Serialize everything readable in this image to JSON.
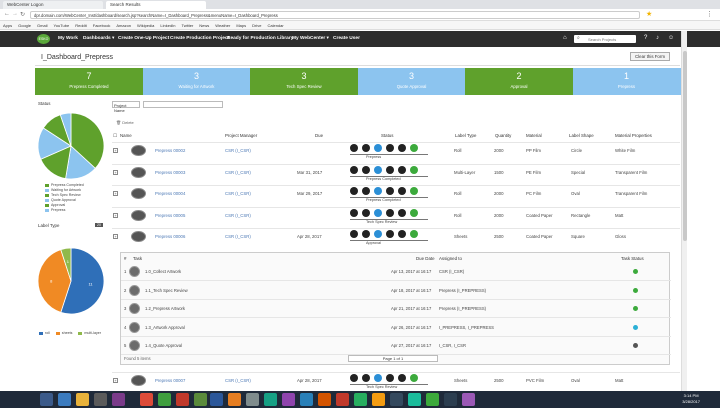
{
  "browser": {
    "tabs": [
      "WebCenter Logon",
      "Search Results"
    ],
    "url": "dpr.domain.com/WebCenter_Inst/dashboard/search.jsp?searchName=I_Dashboard_Prepress&menuName=I_Dashboard_Prepress",
    "bookmarks": [
      "Apps",
      "Google",
      "Gmail",
      "YouTube",
      "Reddit",
      "Facebook",
      "Amazon",
      "Wikipedia",
      "LinkedIn",
      "Twitter",
      "News",
      "Weather",
      "Maps",
      "Drive",
      "Calendar"
    ]
  },
  "nav": {
    "logo": "ESKO",
    "items": [
      "My Work",
      "Dashboards ▾",
      "Create One-Up Project",
      "Create Production Project",
      "Ready for Production Library",
      "My WebCenter ▾",
      "Create User"
    ],
    "search_placeholder": "Search Projects"
  },
  "page": {
    "title": "I_Dashboard_Prepress",
    "clear_button": "Clear this Form"
  },
  "tiles": [
    {
      "num": "7",
      "label": "Prepress Completed",
      "color": "green"
    },
    {
      "num": "3",
      "label": "Waiting for Artwork",
      "color": "blue"
    },
    {
      "num": "3",
      "label": "Tech Spec Review",
      "color": "green"
    },
    {
      "num": "3",
      "label": "Quote Approval",
      "color": "blue"
    },
    {
      "num": "2",
      "label": "Approval",
      "color": "green"
    },
    {
      "num": "1",
      "label": "Prepress",
      "color": "blue"
    }
  ],
  "status_chart": {
    "title": "Status",
    "legend": [
      "Prepress Completed",
      "Waiting for Artwork",
      "Tech Spec Review",
      "Quote Approval",
      "Approval",
      "Prepress"
    ],
    "colors": [
      "#5fa12c",
      "#8cc4ef",
      "#5fa12c",
      "#8cc4ef",
      "#5fa12c",
      "#8cc4ef"
    ],
    "values": [
      7,
      3,
      3,
      3,
      2,
      1
    ]
  },
  "labeltype_chart": {
    "title": "Label Type",
    "badge": "20",
    "legend": [
      "roll",
      "sheets",
      "multi-layer"
    ],
    "colors": [
      "#2f6fb8",
      "#f08a24",
      "#8fb94b"
    ],
    "values": [
      11,
      8,
      1
    ],
    "labels": [
      "11",
      "8",
      "1"
    ]
  },
  "filter": {
    "label": "Project Name",
    "value": "",
    "delete": "Delete"
  },
  "columns": [
    "Name",
    "Project Manager",
    "Due",
    "Status",
    "Label Type",
    "Quantity",
    "Material",
    "Label Shape",
    "Material Properties"
  ],
  "projects": [
    {
      "name": "Prepress 00002",
      "pm": "CSR (I_CSR)",
      "due": "",
      "status": "Prepress",
      "label_type": "Roll",
      "qty": "2000",
      "material": "PP Film",
      "shape": "Circle",
      "props": "White Film"
    },
    {
      "name": "Prepress 00003",
      "pm": "CSR (I_CSR)",
      "due": "Mar 31, 2017",
      "status": "Prepress Completed",
      "label_type": "Multi-Layer",
      "qty": "1500",
      "material": "PE Film",
      "shape": "Special",
      "props": "Transparent Film"
    },
    {
      "name": "Prepress 00004",
      "pm": "CSR (I_CSR)",
      "due": "Mar 29, 2017",
      "status": "Prepress Completed",
      "label_type": "Roll",
      "qty": "2000",
      "material": "PC Film",
      "shape": "Oval",
      "props": "Transparent Film"
    },
    {
      "name": "Prepress 00005",
      "pm": "CSR (I_CSR)",
      "due": "",
      "status": "Tech Spec Review",
      "label_type": "Roll",
      "qty": "2000",
      "material": "Coated Paper",
      "shape": "Rectangle",
      "props": "Matt"
    },
    {
      "name": "Prepress 00006",
      "pm": "CSR (I_CSR)",
      "due": "Apr 28, 2017",
      "status": "Approval",
      "label_type": "Sheets",
      "qty": "2500",
      "material": "Coated Paper",
      "shape": "Square",
      "props": "Gloss"
    }
  ],
  "subtasks": {
    "columns": [
      "#",
      "Task",
      "Due Date",
      "Assigned to",
      "Task Status"
    ],
    "rows": [
      {
        "n": "1",
        "task": "1.0_Collect Artwork",
        "due": "Apr 13, 2017 at 16:17",
        "assigned": "CSR (I_CSR)",
        "status_color": "#3caa3c"
      },
      {
        "n": "2",
        "task": "1.1_Tech Spec Review",
        "due": "Apr 18, 2017 at 16:17",
        "assigned": "Prepress (I_PREPRESS)",
        "status_color": "#3caa3c"
      },
      {
        "n": "3",
        "task": "1.2_Prepress Artwork",
        "due": "Apr 21, 2017 at 16:17",
        "assigned": "Prepress (I_PREPRESS)",
        "status_color": "#3caa3c"
      },
      {
        "n": "4",
        "task": "1.3_Artwork Approval",
        "due": "Apr 26, 2017 at 16:17",
        "assigned": "I_PREPRESS, I_PREPRESS",
        "status_color": "#2bb0d6"
      },
      {
        "n": "5",
        "task": "1.4_Quote Approval",
        "due": "Apr 27, 2017 at 16:17",
        "assigned": "I_CSR, I_CSR",
        "status_color": "#555555"
      }
    ],
    "found": "Found 5 items",
    "pager": "Page 1 of 1"
  },
  "last_project": {
    "name": "Prepress 00007",
    "pm": "CSR (I_CSR)",
    "due": "Apr 28, 2017",
    "status": "Tech Spec Review",
    "label_type": "Sheets",
    "qty": "2500",
    "material": "PVC Film",
    "shape": "Oval",
    "props": "Matt"
  },
  "clock": {
    "time": "3:14 PM",
    "date": "3/28/2017"
  }
}
